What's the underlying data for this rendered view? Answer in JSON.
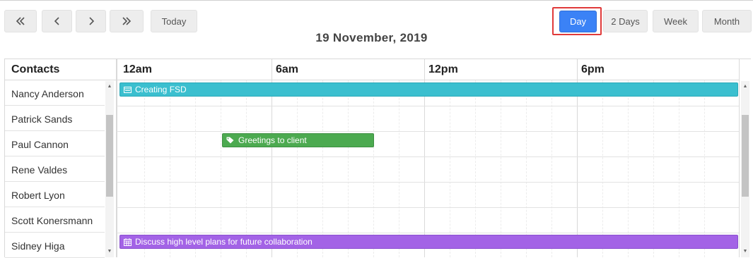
{
  "toolbar": {
    "nav": [
      {
        "name": "first-button",
        "icon": "double-chevron-left-icon"
      },
      {
        "name": "previous-button",
        "icon": "chevron-left-icon"
      },
      {
        "name": "next-button",
        "icon": "chevron-right-icon"
      },
      {
        "name": "last-button",
        "icon": "double-chevron-right-icon"
      }
    ],
    "today_label": "Today",
    "views": [
      {
        "label": "Day",
        "active": true
      },
      {
        "label": "2 Days",
        "active": false
      },
      {
        "label": "Week",
        "active": false
      },
      {
        "label": "Month",
        "active": false
      }
    ]
  },
  "date_title": "19 November, 2019",
  "grid": {
    "contacts_header": "Contacts",
    "contacts": [
      "Nancy Anderson",
      "Patrick Sands",
      "Paul Cannon",
      "Rene Valdes",
      "Robert Lyon",
      "Scott Konersmann",
      "Sidney Higa"
    ],
    "time_labels": [
      "12am",
      "6am",
      "12pm",
      "6pm"
    ]
  },
  "events": [
    {
      "title": "Creating FSD",
      "icon": "card-icon",
      "color": "#3bbfcf",
      "contact": "Nancy Anderson"
    },
    {
      "title": "Greetings to client",
      "icon": "tag-icon",
      "color": "#4caa50",
      "contact": "Paul Cannon"
    },
    {
      "title": "Discuss high level plans for future collaboration",
      "icon": "calendar-icon",
      "color": "#a363e6",
      "contact": "Sidney Higa"
    }
  ],
  "colors": {
    "accent": "#3b82f6",
    "highlight": "#e03a3a"
  }
}
